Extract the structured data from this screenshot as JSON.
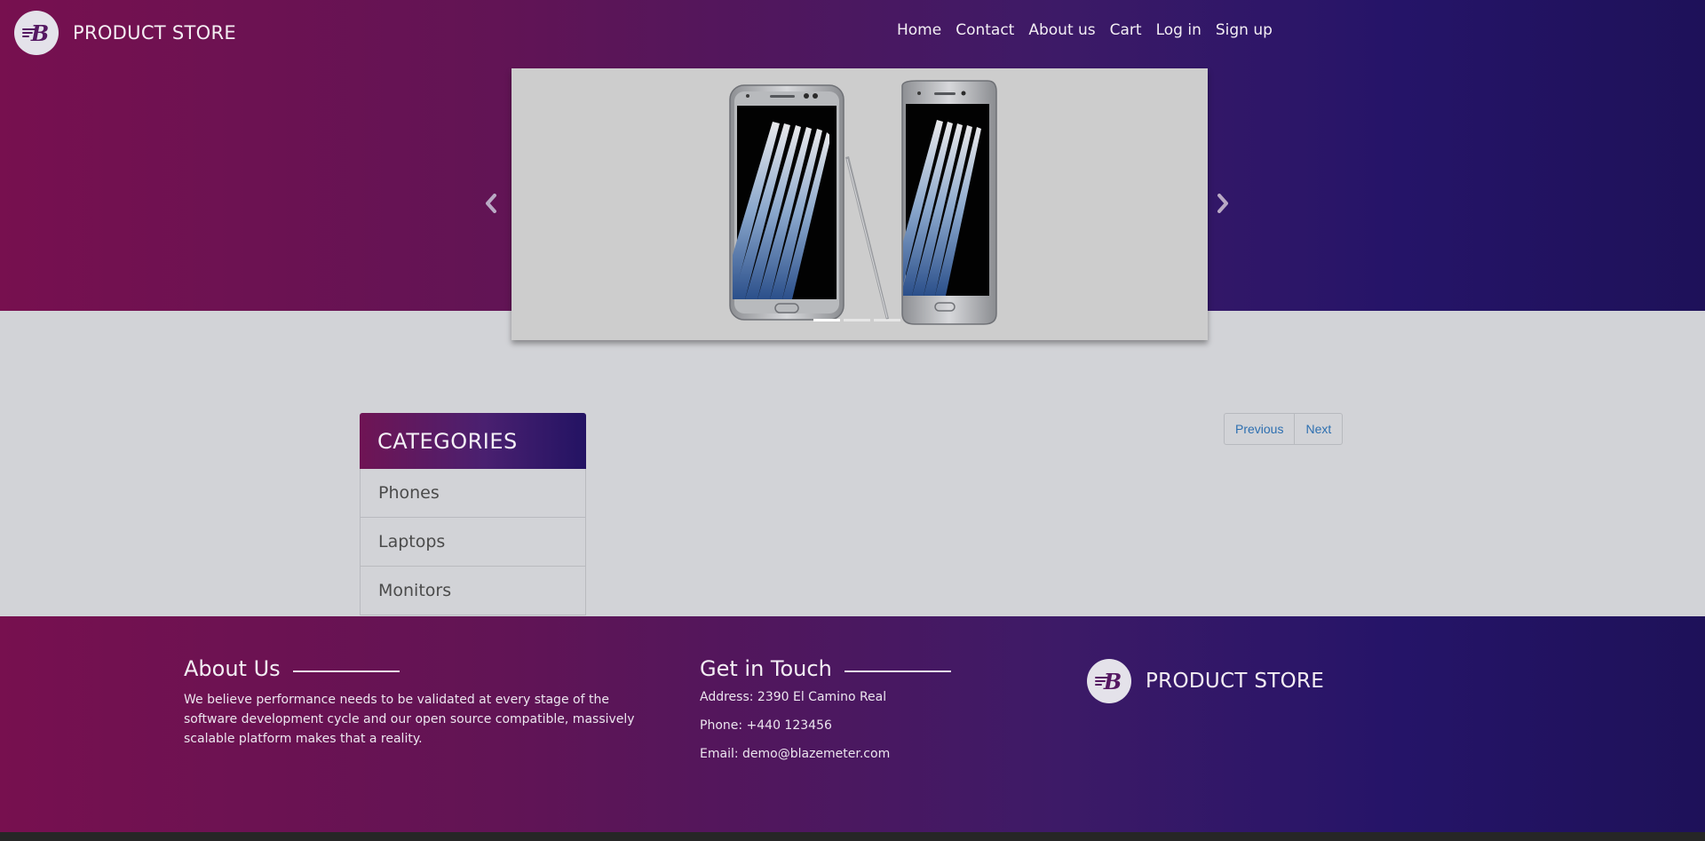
{
  "brand": {
    "name": "PRODUCT STORE",
    "logo_icon": "blazemeter-logo-icon"
  },
  "nav": {
    "items": [
      {
        "label": "Home"
      },
      {
        "label": "Contact"
      },
      {
        "label": "About us"
      },
      {
        "label": "Cart"
      },
      {
        "label": "Log in"
      },
      {
        "label": "Sign up"
      }
    ]
  },
  "carousel": {
    "prev_icon": "chevron-left-icon",
    "next_icon": "chevron-right-icon",
    "slides": 3,
    "active_slide": 1
  },
  "categories": {
    "title": "CATEGORIES",
    "items": [
      {
        "label": "Phones"
      },
      {
        "label": "Laptops"
      },
      {
        "label": "Monitors"
      }
    ]
  },
  "pagination": {
    "previous_label": "Previous",
    "next_label": "Next"
  },
  "footer": {
    "about": {
      "title": "About Us",
      "text": "We believe performance needs to be validated at every stage of the software development cycle and our open source compatible, massively scalable platform makes that a reality."
    },
    "contact": {
      "title": "Get in Touch",
      "address": "Address: 2390 El Camino Real",
      "phone": "Phone: +440 123456",
      "email": "Email: demo@blazemeter.com"
    },
    "brand_name": "PRODUCT STORE"
  },
  "colors": {
    "gradient_start": "#77104f",
    "gradient_end": "#1e1159",
    "page_background": "#d2d3d7",
    "link_blue": "#2d6fb0"
  }
}
